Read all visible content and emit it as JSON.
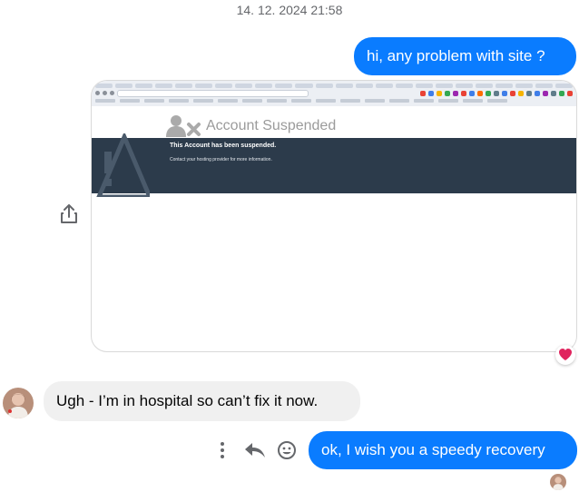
{
  "conversation": {
    "timestamp": "14. 12. 2024 21:58",
    "messages": [
      {
        "from": "me",
        "text": "hi, any problem with site ?"
      },
      {
        "from": "me",
        "type": "screenshot",
        "reaction": "heart"
      },
      {
        "from": "them",
        "text": "Ugh - I’m in hospital so can’t fix it now."
      },
      {
        "from": "me",
        "text": "ok, I wish you a speedy recovery"
      }
    ]
  },
  "screenshot": {
    "heading": "Account Suspended",
    "band_title": "This Account has been suspended.",
    "band_subtitle": "Contact your hosting provider for more information."
  },
  "colors": {
    "outgoing_bubble": "#0a7cff",
    "incoming_bubble": "#f0f0f0",
    "suspended_band": "#2c3b4b",
    "heart": "#e0245e"
  },
  "icons": [
    "share-icon",
    "heart-reaction-icon",
    "more-options-icon",
    "reply-icon",
    "react-emoji-icon"
  ]
}
